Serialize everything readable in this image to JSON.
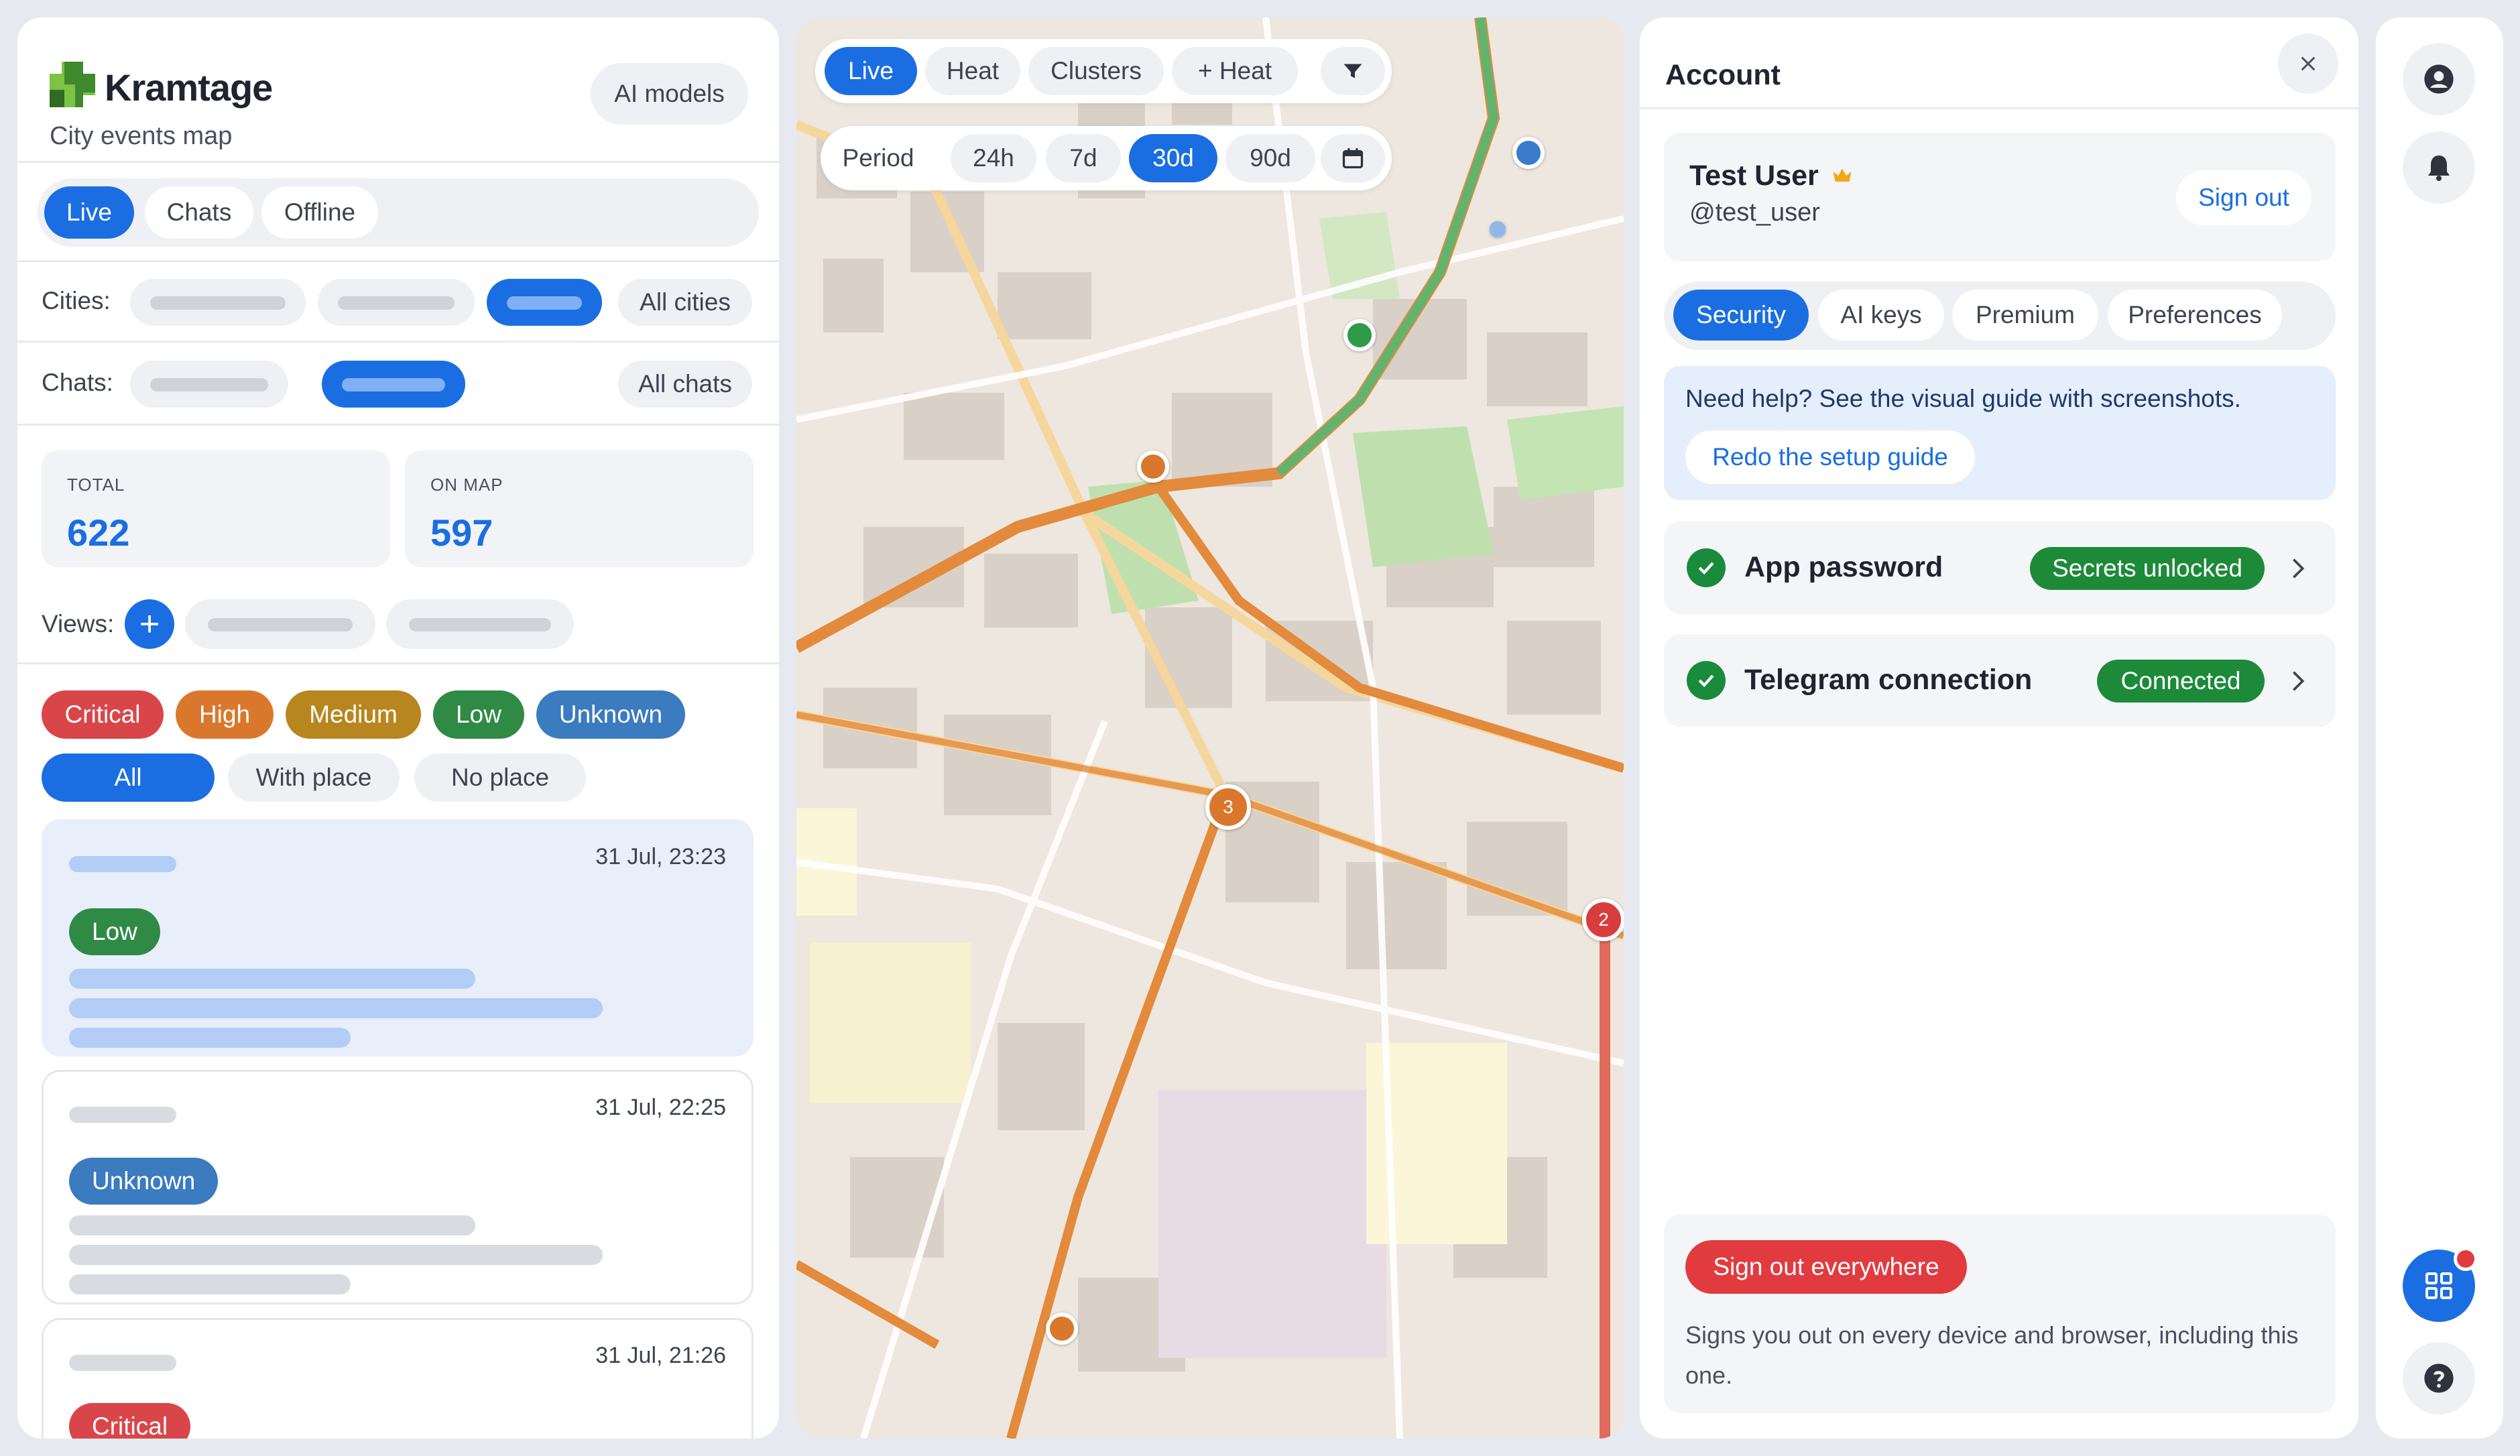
{
  "brand": {
    "name": "Kramtage",
    "subtitle": "City events map",
    "ai_models_label": "AI models"
  },
  "left_tabs": {
    "live": "Live",
    "chats": "Chats",
    "offline": "Offline"
  },
  "filters": {
    "cities_label": "Cities:",
    "all_cities": "All cities",
    "chats_label": "Chats:",
    "all_chats": "All chats",
    "views_label": "Views:",
    "views_add": "+"
  },
  "stats": {
    "total_label": "TOTAL",
    "total_value": "622",
    "on_map_label": "ON MAP",
    "on_map_value": "597"
  },
  "severity": [
    {
      "label": "Critical",
      "color": "#d9464a"
    },
    {
      "label": "High",
      "color": "#d9782d"
    },
    {
      "label": "Medium",
      "color": "#b8861e"
    },
    {
      "label": "Low",
      "color": "#2f8a45"
    },
    {
      "label": "Unknown",
      "color": "#3b7bbf"
    }
  ],
  "place_filter": {
    "all": "All",
    "with_place": "With place",
    "no_place": "No place"
  },
  "events": [
    {
      "time": "31 Jul, 23:23",
      "badge": "Low",
      "badge_color": "#2f8a45"
    },
    {
      "time": "31 Jul, 22:25",
      "badge": "Unknown",
      "badge_color": "#3b7bbf"
    },
    {
      "time": "31 Jul, 21:26",
      "badge": "Critical",
      "badge_color": "#d9464a"
    }
  ],
  "map": {
    "modes": {
      "live": "Live",
      "heat": "Heat",
      "clusters": "Clusters",
      "plus_heat": "+ Heat"
    },
    "period_label": "Period",
    "periods": {
      "p24h": "24h",
      "p7d": "7d",
      "p30d": "30d",
      "p90d": "90d"
    },
    "cluster_counts": {
      "orange": "3",
      "red": "2"
    }
  },
  "account": {
    "title": "Account",
    "user_name": "Test User",
    "user_handle": "@test_user",
    "sign_out": "Sign out",
    "tabs": {
      "security": "Security",
      "ai_keys": "AI keys",
      "premium": "Premium",
      "preferences": "Preferences"
    },
    "help_text": "Need help? See the visual guide with screenshots.",
    "redo_guide": "Redo the setup guide",
    "app_password": {
      "title": "App password",
      "status": "Secrets unlocked"
    },
    "telegram": {
      "title": "Telegram connection",
      "status": "Connected"
    },
    "sign_out_everywhere": "Sign out everywhere",
    "sign_out_note": "Signs you out on every device and browser, including this one."
  },
  "colors": {
    "accent": "#1a6ee2",
    "success": "#1d8a3a",
    "danger": "#e13b40"
  }
}
